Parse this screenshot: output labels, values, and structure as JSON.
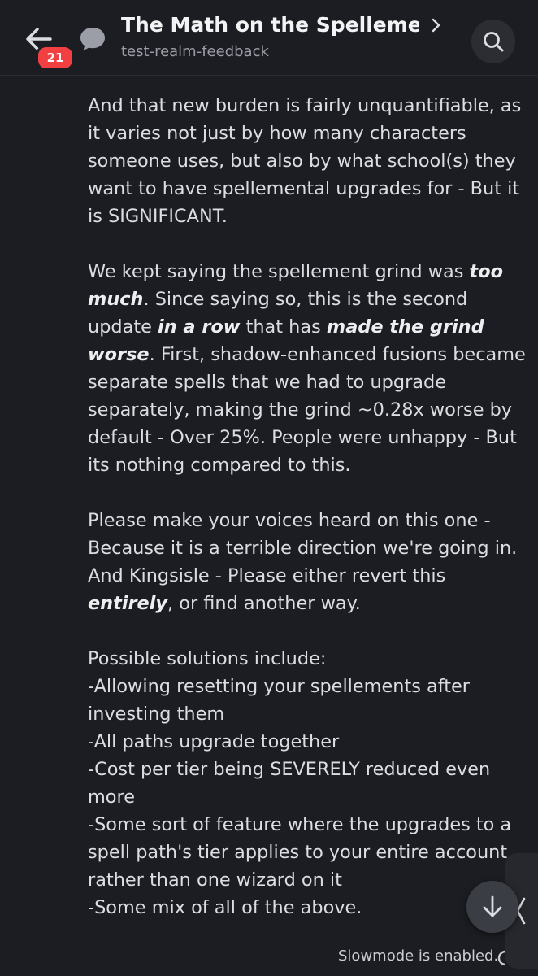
{
  "header": {
    "title": "The Math on the Spellement…",
    "channel": "test-realm-feedback",
    "unread_badge": "21",
    "back_icon": "arrow-left-icon",
    "thread_icon": "chat-bubble-icon",
    "chevron_icon": "chevron-right-icon",
    "search_icon": "search-icon"
  },
  "message": {
    "p1": "And that new burden is fairly unquantifiable, as it varies not just by how many characters someone uses, but also by what school(s) they want to have spellemental upgrades for - But it is SIGNIFICANT.",
    "p2": {
      "a": "We kept saying the spellement grind was ",
      "b": "too much",
      "c": ". Since saying so, this is the second update ",
      "d": "in a row",
      "e": " that has ",
      "f": "made the grind worse",
      "g": ". First, shadow-enhanced fusions became separate spells that we had to upgrade separately, making the grind ~0.28x worse by default - Over 25%. People were unhappy - But its nothing compared to this."
    },
    "p3": {
      "a": "Please make your voices heard on this one - Because it is a terrible direction we're going in. And Kingsisle - Please either revert this ",
      "b": "entirely",
      "c": ", or find another way."
    },
    "p4": {
      "intro": "Possible solutions include:",
      "items": [
        "-Allowing resetting your spellements after investing them",
        "-All paths upgrade together",
        "-Cost per tier being SEVERELY reduced even more",
        "-Some sort of feature where the upgrades to a spell path's tier applies to your entire account rather than one wizard on it",
        "-Some mix of all of the above."
      ]
    }
  },
  "footer": {
    "slowmode": "Slowmode is enabled.",
    "scroll_down_icon": "arrow-down-icon",
    "drawer_icon": "chevron-left-icon",
    "slowmode_icon": "timer-icon"
  },
  "colors": {
    "background": "#1c1d22",
    "text": "#dbdee1",
    "badge": "#f23f42"
  }
}
